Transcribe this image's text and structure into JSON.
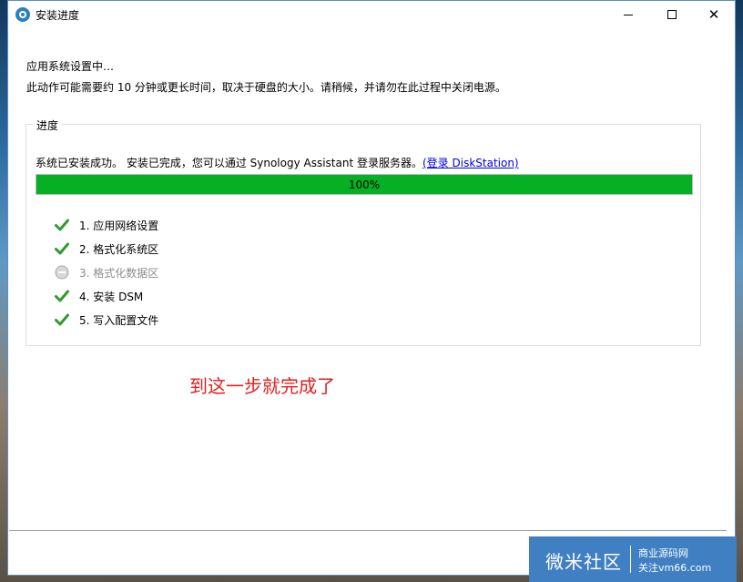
{
  "window": {
    "title": "安装进度"
  },
  "header": {
    "line1": "应用系统设置中…",
    "line2": "此动作可能需要约 10 分钟或更长时间，取决于硬盘的大小。请稍候，并请勿在此过程中关闭电源。"
  },
  "progress_group": {
    "legend": "进度",
    "status_text": "系统已安装成功。 安装已完成，您可以通过 Synology Assistant 登录服务器。",
    "status_link": "(登录 DiskStation)",
    "progress_percent": 100,
    "progress_label": "100%",
    "progress_color": "#06b025",
    "steps": [
      {
        "label": "1. 应用网络设置",
        "state": "done",
        "icon": "check-icon"
      },
      {
        "label": "2. 格式化系统区",
        "state": "done",
        "icon": "check-icon"
      },
      {
        "label": "3. 格式化数据区",
        "state": "skipped",
        "icon": "minus-circle-icon"
      },
      {
        "label": "4. 安装 DSM",
        "state": "done",
        "icon": "check-icon"
      },
      {
        "label": "5. 写入配置文件",
        "state": "done",
        "icon": "check-icon"
      }
    ]
  },
  "annotation": {
    "text": "到这一步就完成了",
    "color": "#e02020"
  },
  "watermark": {
    "main": "微米社区",
    "line1": "商业源码网",
    "line2": "关注vm66.com"
  }
}
